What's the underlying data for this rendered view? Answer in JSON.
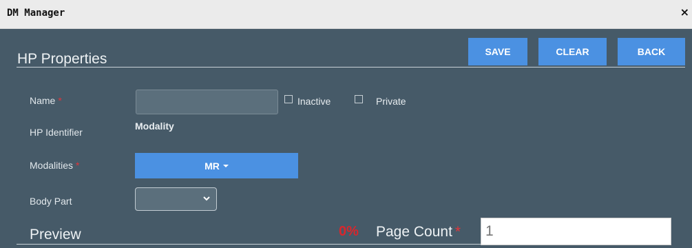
{
  "window": {
    "title": "DM Manager",
    "close_glyph": "×"
  },
  "header": {
    "title": "HP Properties"
  },
  "toolbar": {
    "save_label": "SAVE",
    "clear_label": "CLEAR",
    "back_label": "BACK",
    "accent_color": "#4b91e2"
  },
  "form": {
    "name": {
      "label": "Name",
      "required_mark": "*",
      "value": ""
    },
    "inactive": {
      "label": "Inactive",
      "checked": false
    },
    "private": {
      "label": "Private",
      "checked": false
    },
    "hp_identifier": {
      "label": "HP Identifier",
      "value": "Modality"
    },
    "modalities": {
      "label": "Modalities",
      "required_mark": "*",
      "selected": "MR"
    },
    "body_part": {
      "label": "Body Part",
      "selected": ""
    }
  },
  "preview": {
    "title": "Preview",
    "percent": "0%",
    "page_count_label": "Page Count",
    "page_count_required_mark": "*",
    "page_count_placeholder": "1"
  }
}
